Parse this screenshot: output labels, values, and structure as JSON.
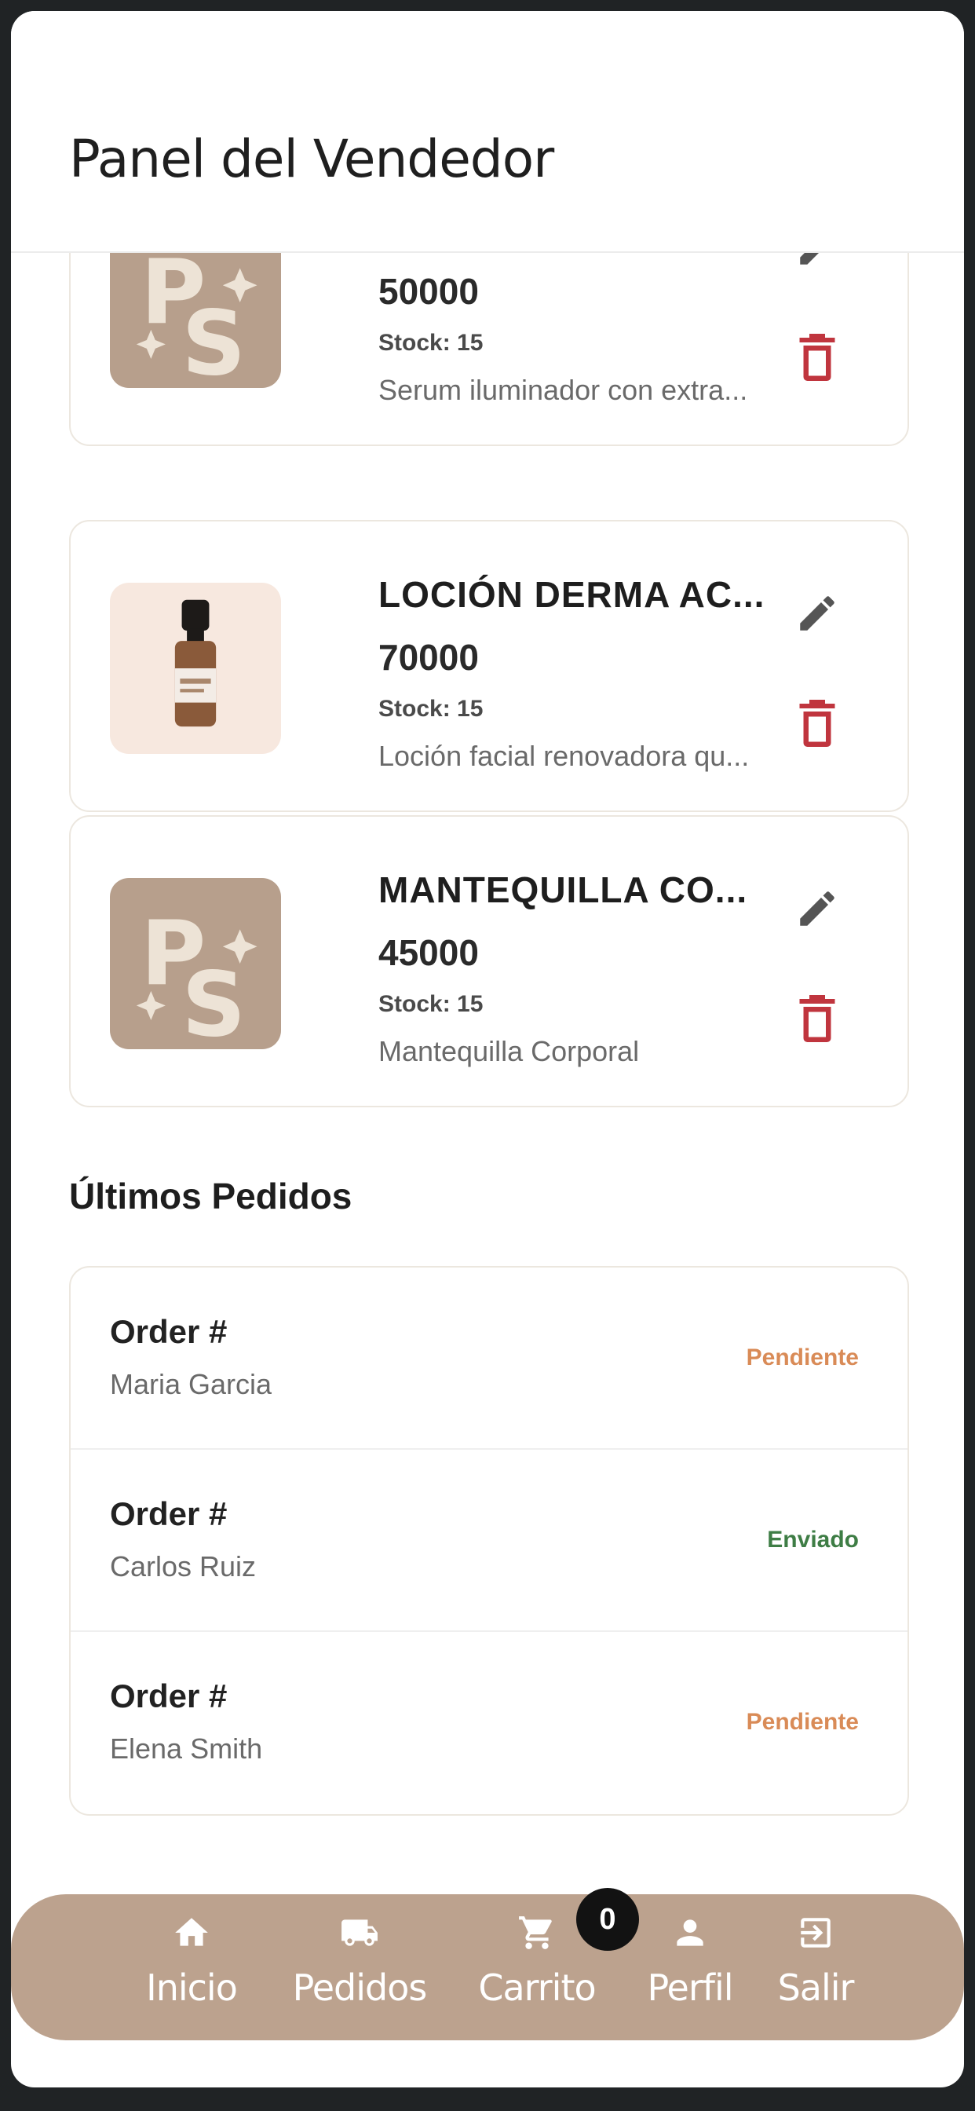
{
  "header": {
    "title": "Panel del Vendedor"
  },
  "products": [
    {
      "name": "",
      "price": "50000",
      "stock": "Stock: 15",
      "description": "Serum iluminador con extra...",
      "image": "ps-logo"
    },
    {
      "name": "LOCIÓN DERMA AC...",
      "price": "70000",
      "stock": "Stock: 15",
      "description": "Loción facial renovadora qu...",
      "image": "dropper-bottle"
    },
    {
      "name": "MANTEQUILLA CO...",
      "price": "45000",
      "stock": "Stock: 15",
      "description": "Mantequilla Corporal",
      "image": "ps-logo"
    }
  ],
  "orders_section": {
    "title": "Últimos Pedidos"
  },
  "orders": [
    {
      "id": "Order #",
      "client": "Maria Garcia",
      "status": "Pendiente",
      "status_color": "#d98b57"
    },
    {
      "id": "Order #",
      "client": "Carlos Ruiz",
      "status": "Enviado",
      "status_color": "#3e7d45"
    },
    {
      "id": "Order #",
      "client": "Elena Smith",
      "status": "Pendiente",
      "status_color": "#d98b57"
    }
  ],
  "nav": {
    "items": [
      {
        "label": "Inicio",
        "icon": "home-icon"
      },
      {
        "label": "Pedidos",
        "icon": "truck-icon"
      },
      {
        "label": "Carrito",
        "icon": "cart-icon"
      },
      {
        "label": "Perfil",
        "icon": "person-icon"
      },
      {
        "label": "Salir",
        "icon": "logout-icon"
      }
    ],
    "cart_count": "0"
  },
  "colors": {
    "brand": "#bca28e",
    "logo_tile": "#b79f8c",
    "delete": "#c0353e",
    "edit": "#555555",
    "pending": "#d98b57",
    "shipped": "#3e7d45"
  }
}
